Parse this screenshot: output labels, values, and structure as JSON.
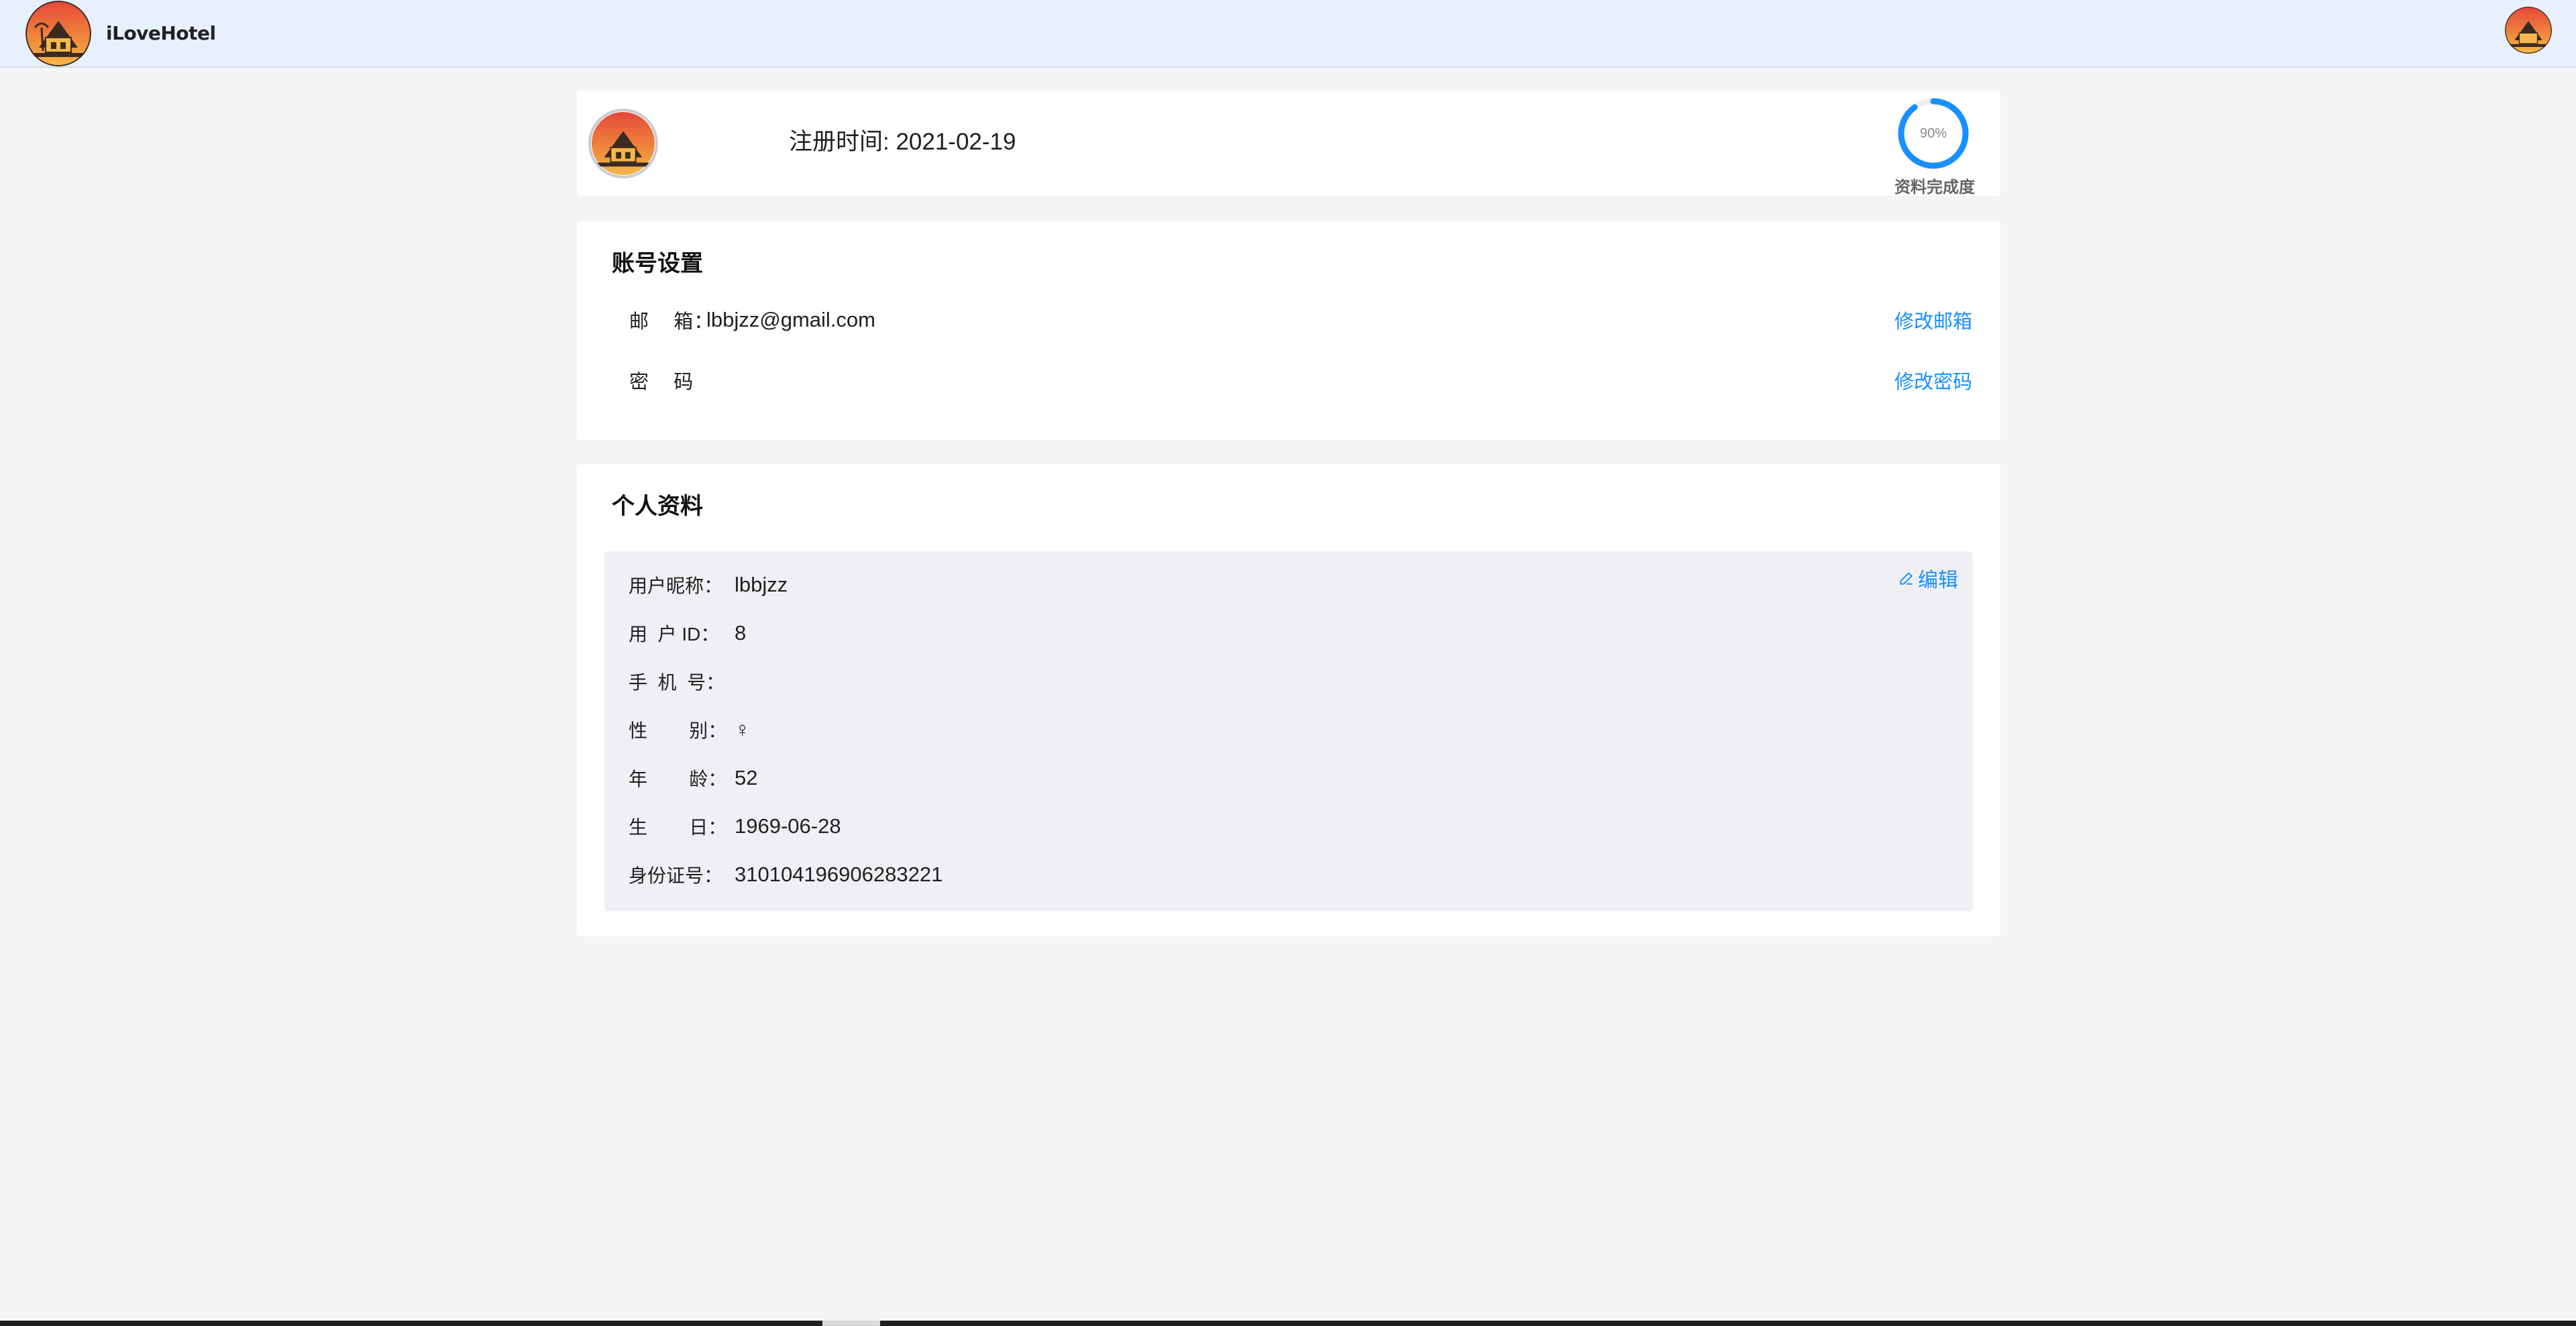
{
  "header": {
    "brand": "iLoveHotel",
    "logo_icon": "hotel-logo-icon",
    "avatar_icon": "user-avatar-icon"
  },
  "profile": {
    "registration_label": "注册时间: 2021-02-19",
    "completion_percent": 90,
    "completion_text": "90%",
    "completion_label": "资料完成度",
    "progress_color": "#1890ff"
  },
  "account": {
    "title": "账号设置",
    "email_label": "邮    箱：",
    "email_value": "lbbjzz@gmail.com",
    "email_action": "修改邮箱",
    "password_label": "密    码",
    "password_action": "修改密码"
  },
  "personal": {
    "title": "个人资料",
    "edit_label": "编辑",
    "edit_icon": "edit-icon",
    "fields": [
      {
        "label": "用户昵称：",
        "value": "lbbjzz"
      },
      {
        "label": "用  户 ID：",
        "value": "8"
      },
      {
        "label": "手  机  号：",
        "value": ""
      },
      {
        "label": "性        别：",
        "value": "♀"
      },
      {
        "label": "年        龄：",
        "value": "52"
      },
      {
        "label": "生        日：",
        "value": "1969-06-28"
      },
      {
        "label": "身份证号：",
        "value": "310104196906283221"
      }
    ]
  },
  "colors": {
    "accent": "#1890ff",
    "header_bg": "#e9f0fd",
    "page_bg": "#f4f5f7"
  }
}
